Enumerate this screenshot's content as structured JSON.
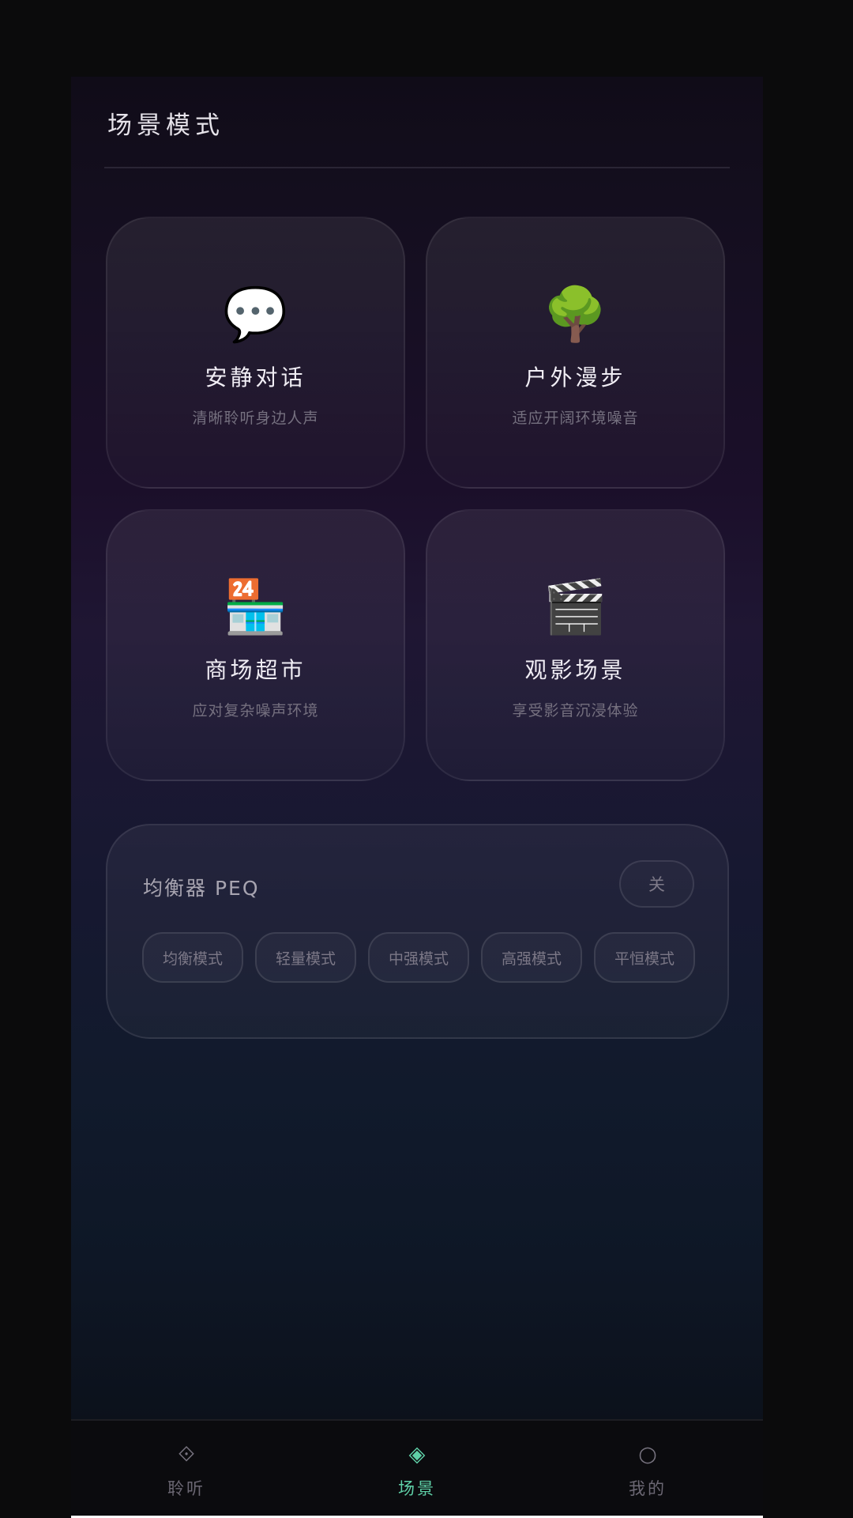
{
  "header": {
    "title": "场景模式"
  },
  "scenes": [
    {
      "icon": "💬",
      "icon_name": "speech-bubble-icon",
      "title": "安静对话",
      "desc": "清晰聆听身边人声"
    },
    {
      "icon": "🌳",
      "icon_name": "tree-icon",
      "title": "户外漫步",
      "desc": "适应开阔环境噪音"
    },
    {
      "icon": "🏪",
      "icon_name": "convenience-store-icon",
      "title": "商场超市",
      "desc": "应对复杂噪声环境"
    },
    {
      "icon": "🎬",
      "icon_name": "clapperboard-icon",
      "title": "观影场景",
      "desc": "享受影音沉浸体验"
    }
  ],
  "eq": {
    "title": "均衡器 PEQ",
    "toggle_label": "关",
    "modes": [
      "均衡模式",
      "轻量模式",
      "中强模式",
      "高强模式",
      "平恒模式"
    ]
  },
  "tabs": [
    {
      "icon": "⟐",
      "icon_name": "diamond-dot-icon",
      "label": "聆听",
      "active": false
    },
    {
      "icon": "◈",
      "icon_name": "diamond-filled-icon",
      "label": "场景",
      "active": true
    },
    {
      "icon": "○",
      "icon_name": "circle-icon",
      "label": "我的",
      "active": false
    }
  ],
  "colors": {
    "accent": "#5fd0a7",
    "background": "#0b0b0c"
  }
}
